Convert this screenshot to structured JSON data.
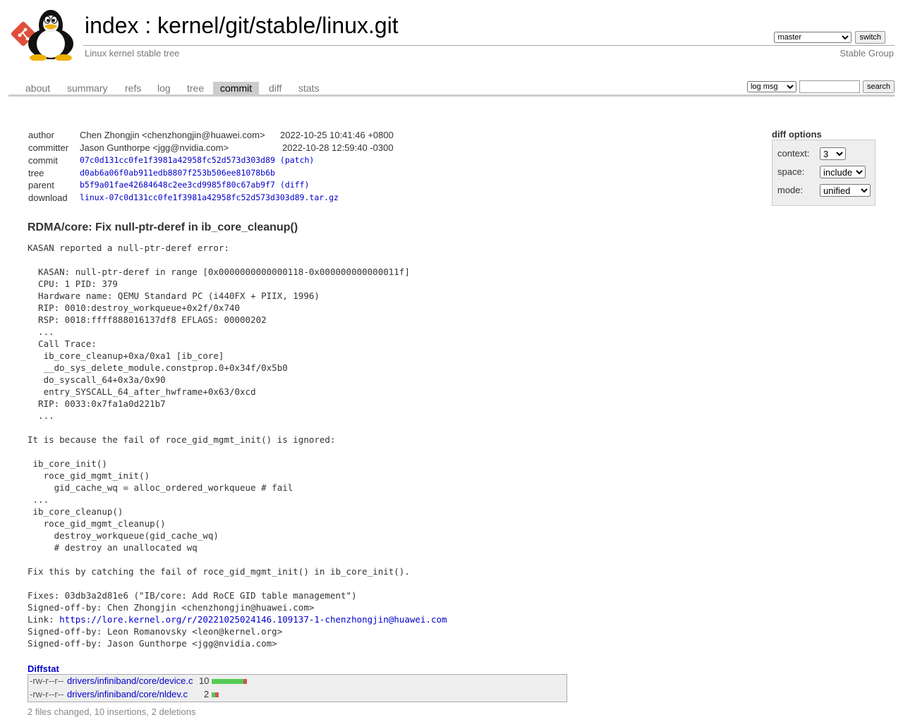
{
  "header": {
    "title_index": "index",
    "title_sep": " : ",
    "title_repo": "kernel/git/stable/linux.git",
    "subtitle": "Linux kernel stable tree",
    "owner": "Stable Group",
    "branch_selected": "master",
    "switch_label": "switch"
  },
  "tabs": [
    {
      "label": "about"
    },
    {
      "label": "summary"
    },
    {
      "label": "refs"
    },
    {
      "label": "log"
    },
    {
      "label": "tree"
    },
    {
      "label": "commit",
      "active": true
    },
    {
      "label": "diff"
    },
    {
      "label": "stats"
    }
  ],
  "search": {
    "selected": "log msg",
    "value": "",
    "button_label": "search"
  },
  "commit_info": {
    "author_label": "author",
    "author": "Chen Zhongjin <chenzhongjin@huawei.com>",
    "author_date": "2022-10-25 10:41:46 +0800",
    "committer_label": "committer",
    "committer": "Jason Gunthorpe <jgg@nvidia.com>",
    "committer_date": "2022-10-28 12:59:40 -0300",
    "commit_label": "commit",
    "commit_hash": "07c0d131cc0fe1f3981a42958fc52d573d303d89",
    "commit_extra": "(patch)",
    "tree_label": "tree",
    "tree_hash": "d0ab6a06f0ab911edb8807f253b506ee81078b6b",
    "parent_label": "parent",
    "parent_hash": "b5f9a01fae42684648c2ee3cd9985f80c67ab9f7",
    "parent_extra": "(diff)",
    "download_label": "download",
    "download_file": "linux-07c0d131cc0fe1f3981a42958fc52d573d303d89.tar.gz"
  },
  "diff_options": {
    "title": "diff options",
    "context_label": "context:",
    "context_value": "3",
    "space_label": "space:",
    "space_value": "include",
    "mode_label": "mode:",
    "mode_value": "unified"
  },
  "subject": "RDMA/core: Fix null-ptr-deref in ib_core_cleanup()",
  "message_before_link": "KASAN reported a null-ptr-deref error:\n\n  KASAN: null-ptr-deref in range [0x0000000000000118-0x000000000000011f]\n  CPU: 1 PID: 379\n  Hardware name: QEMU Standard PC (i440FX + PIIX, 1996)\n  RIP: 0010:destroy_workqueue+0x2f/0x740\n  RSP: 0018:ffff888016137df8 EFLAGS: 00000202\n  ...\n  Call Trace:\n   ib_core_cleanup+0xa/0xa1 [ib_core]\n   __do_sys_delete_module.constprop.0+0x34f/0x5b0\n   do_syscall_64+0x3a/0x90\n   entry_SYSCALL_64_after_hwframe+0x63/0xcd\n  RIP: 0033:0x7fa1a0d221b7\n  ...\n\nIt is because the fail of roce_gid_mgmt_init() is ignored:\n\n ib_core_init()\n   roce_gid_mgmt_init()\n     gid_cache_wq = alloc_ordered_workqueue # fail\n ...\n ib_core_cleanup()\n   roce_gid_mgmt_cleanup()\n     destroy_workqueue(gid_cache_wq)\n     # destroy an unallocated wq\n\nFix this by catching the fail of roce_gid_mgmt_init() in ib_core_init().\n\nFixes: 03db3a2d81e6 (\"IB/core: Add RoCE GID table management\")\nSigned-off-by: Chen Zhongjin <chenzhongjin@huawei.com>\nLink: ",
  "message_link": "https://lore.kernel.org/r/20221025024146.109137-1-chenzhongjin@huawei.com",
  "message_after_link": "\nSigned-off-by: Leon Romanovsky <leon@kernel.org>\nSigned-off-by: Jason Gunthorpe <jgg@nvidia.com>",
  "diffstat": {
    "title": "Diffstat",
    "files": [
      {
        "mode": "-rw-r--r--",
        "path": "drivers/infiniband/core/device.c",
        "count": "10",
        "insertions": 9,
        "deletions": 1
      },
      {
        "mode": "-rw-r--r--",
        "path": "drivers/infiniband/core/nldev.c",
        "count": "2",
        "insertions": 1,
        "deletions": 1
      }
    ],
    "summary": "2 files changed, 10 insertions, 2 deletions"
  },
  "colors": {
    "link": "#0000cc",
    "insert": "#55cc55",
    "delete": "#cc5555"
  }
}
